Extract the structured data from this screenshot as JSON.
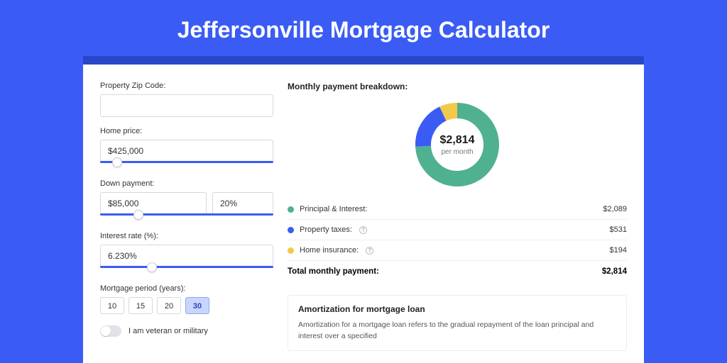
{
  "title": "Jeffersonville Mortgage Calculator",
  "form": {
    "zip_label": "Property Zip Code:",
    "zip_value": "",
    "home_price_label": "Home price:",
    "home_price_value": "$425,000",
    "home_price_slider_pct": 10,
    "down_payment_label": "Down payment:",
    "down_payment_value": "$85,000",
    "down_payment_pct": "20%",
    "down_payment_slider_pct": 22,
    "interest_label": "Interest rate (%):",
    "interest_value": "6.230%",
    "interest_slider_pct": 30,
    "period_label": "Mortgage period (years):",
    "period_options": [
      "10",
      "15",
      "20",
      "30"
    ],
    "period_selected": "30",
    "veteran_label": "I am veteran or military"
  },
  "breakdown": {
    "title": "Monthly payment breakdown:",
    "center_amount": "$2,814",
    "center_sub": "per month",
    "colors": {
      "principal": "#4fb18f",
      "taxes": "#3a5cf4",
      "insurance": "#f2c94c"
    },
    "items": [
      {
        "label": "Principal & Interest:",
        "value": "$2,089",
        "colorKey": "principal",
        "info": false
      },
      {
        "label": "Property taxes:",
        "value": "$531",
        "colorKey": "taxes",
        "info": true
      },
      {
        "label": "Home insurance:",
        "value": "$194",
        "colorKey": "insurance",
        "info": true
      }
    ],
    "total_label": "Total monthly payment:",
    "total_value": "$2,814"
  },
  "chart_data": {
    "type": "pie",
    "title": "Monthly payment breakdown",
    "series": [
      {
        "name": "Principal & Interest",
        "value": 2089,
        "color": "#4fb18f"
      },
      {
        "name": "Property taxes",
        "value": 531,
        "color": "#3a5cf4"
      },
      {
        "name": "Home insurance",
        "value": 194,
        "color": "#f2c94c"
      }
    ],
    "total": 2814,
    "center_label": "$2,814 per month"
  },
  "amortization": {
    "title": "Amortization for mortgage loan",
    "body": "Amortization for a mortgage loan refers to the gradual repayment of the loan principal and interest over a specified"
  }
}
